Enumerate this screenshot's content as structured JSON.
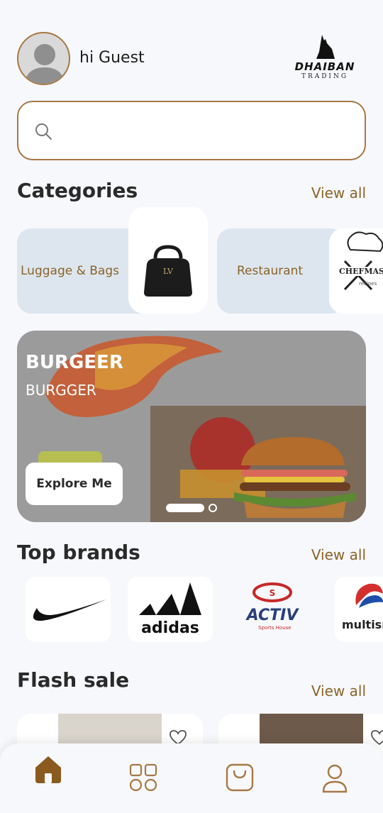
{
  "header": {
    "greeting": "hi Guest",
    "logo_name": "DHAIBAN",
    "logo_sub": "TRADING"
  },
  "search": {
    "placeholder": ""
  },
  "categories": {
    "title": "Categories",
    "view_all": "View all",
    "items": [
      {
        "label": "Luggage & Bags"
      },
      {
        "label": "Restaurant"
      }
    ],
    "third_logo": "CHEFMASTER",
    "third_logo_sub": "recipes"
  },
  "banner": {
    "title": "BURGEER",
    "subtitle": "BURGGER",
    "button": "Explore Me"
  },
  "top_brands": {
    "title": "Top brands",
    "view_all": "View all",
    "brands": [
      {
        "name": "nike"
      },
      {
        "name": "adidas"
      },
      {
        "name": "ACTIV",
        "sub": "Sports House"
      },
      {
        "name": "multism"
      }
    ]
  },
  "flash_sale": {
    "title": "Flash sale",
    "view_all": "View all"
  },
  "colors": {
    "accent": "#a77845",
    "accent_text": "#8a6429",
    "category_bg": "#dde6ee",
    "background": "#f7f8fb"
  }
}
